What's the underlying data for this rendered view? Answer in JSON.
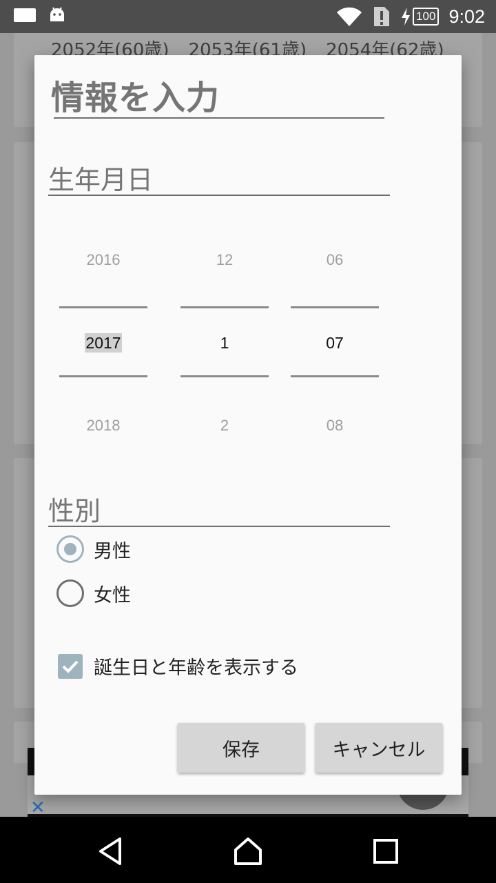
{
  "status_bar": {
    "time": "9:02",
    "battery": "100",
    "icons": [
      "notification-icon",
      "android-icon",
      "wifi-icon",
      "sim-alert-icon",
      "charging-icon",
      "battery-icon"
    ]
  },
  "background": {
    "years": [
      "2052年(60歳)",
      "2053年(61歳)",
      "2054年(62歳)"
    ]
  },
  "dialog": {
    "title": "情報を入力",
    "birthdate_label": "生年月日",
    "picker": {
      "year": {
        "prev": "2016",
        "current": "2017",
        "next": "2018"
      },
      "month": {
        "prev": "12",
        "current": "1",
        "next": "2"
      },
      "day": {
        "prev": "06",
        "current": "07",
        "next": "08"
      }
    },
    "gender_label": "性別",
    "gender_options": [
      {
        "label": "男性",
        "selected": true
      },
      {
        "label": "女性",
        "selected": false
      }
    ],
    "show_age_checkbox": {
      "label": "誕生日と年齢を表示する",
      "checked": true
    },
    "save_button": "保存",
    "cancel_button": "キャンセル"
  },
  "colors": {
    "accent": "#9fb3bf",
    "dialog_bg": "#fafafa",
    "button_bg": "#d6d6d6"
  }
}
